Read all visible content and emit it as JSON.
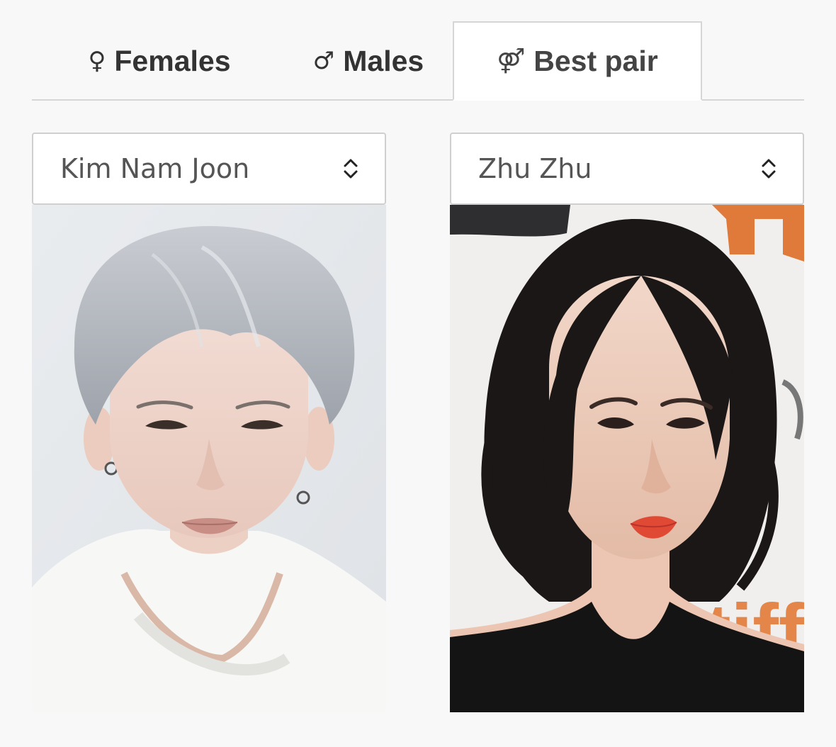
{
  "tabs": [
    {
      "label": "Females",
      "icon": "female-icon",
      "glyph": "♀",
      "active": false
    },
    {
      "label": "Males",
      "icon": "male-icon",
      "glyph": "♂",
      "active": false
    },
    {
      "label": "Best pair",
      "icon": "couple-icon",
      "glyph": "⚤",
      "active": true
    }
  ],
  "left": {
    "selected_value": "Kim Nam Joon",
    "photo_icon": "male-portrait-photo"
  },
  "right": {
    "selected_value": "Zhu Zhu",
    "photo_icon": "female-portrait-photo",
    "backdrop_text": "tiff"
  },
  "colors": {
    "page_bg": "#f8f8f8",
    "tab_border": "#d6d6d6",
    "select_border": "#cfcfcf",
    "text_dark": "#333333",
    "text_mid": "#555555"
  }
}
